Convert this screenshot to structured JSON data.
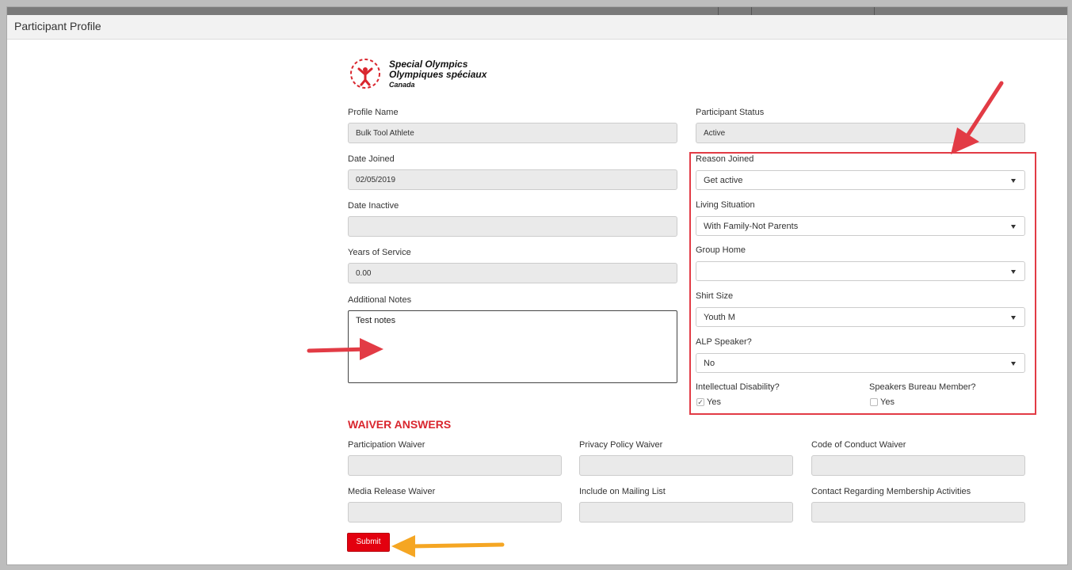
{
  "header": {
    "title": "Participant Profile"
  },
  "logo": {
    "line1": "Special Olympics",
    "line2": "Olympiques spéciaux",
    "line3": "Canada"
  },
  "fields": {
    "profile_name": {
      "label": "Profile Name",
      "value": "Bulk Tool Athlete"
    },
    "participant_status": {
      "label": "Participant Status",
      "value": "Active"
    },
    "date_joined": {
      "label": "Date Joined",
      "value": "02/05/2019"
    },
    "date_inactive": {
      "label": "Date Inactive",
      "value": ""
    },
    "years_of_service": {
      "label": "Years of Service",
      "value": "0.00"
    },
    "additional_notes": {
      "label": "Additional Notes",
      "value": "Test notes"
    }
  },
  "selects": {
    "reason_joined": {
      "label": "Reason Joined",
      "value": "Get active"
    },
    "living_situation": {
      "label": "Living Situation",
      "value": "With Family-Not Parents"
    },
    "group_home": {
      "label": "Group Home",
      "value": ""
    },
    "shirt_size": {
      "label": "Shirt Size",
      "value": "Youth M"
    },
    "alp_speaker": {
      "label": "ALP Speaker?",
      "value": "No"
    }
  },
  "checkboxes": {
    "intellectual_disability": {
      "label": "Intellectual Disability?",
      "option": "Yes",
      "checked": true
    },
    "speakers_bureau": {
      "label": "Speakers Bureau Member?",
      "option": "Yes",
      "checked": false
    }
  },
  "waiver": {
    "title": "WAIVER ANSWERS",
    "participation": {
      "label": "Participation Waiver",
      "value": ""
    },
    "privacy_policy": {
      "label": "Privacy Policy Waiver",
      "value": ""
    },
    "code_of_conduct": {
      "label": "Code of Conduct Waiver",
      "value": ""
    },
    "media_release": {
      "label": "Media Release Waiver",
      "value": ""
    },
    "mailing_list": {
      "label": "Include on Mailing List",
      "value": ""
    },
    "contact_membership": {
      "label": "Contact Regarding Membership Activities",
      "value": ""
    }
  },
  "actions": {
    "submit_label": "Submit"
  },
  "colors": {
    "brand_red": "#e3000f",
    "annotation_red": "#e23b45",
    "annotation_orange": "#f5a623"
  }
}
